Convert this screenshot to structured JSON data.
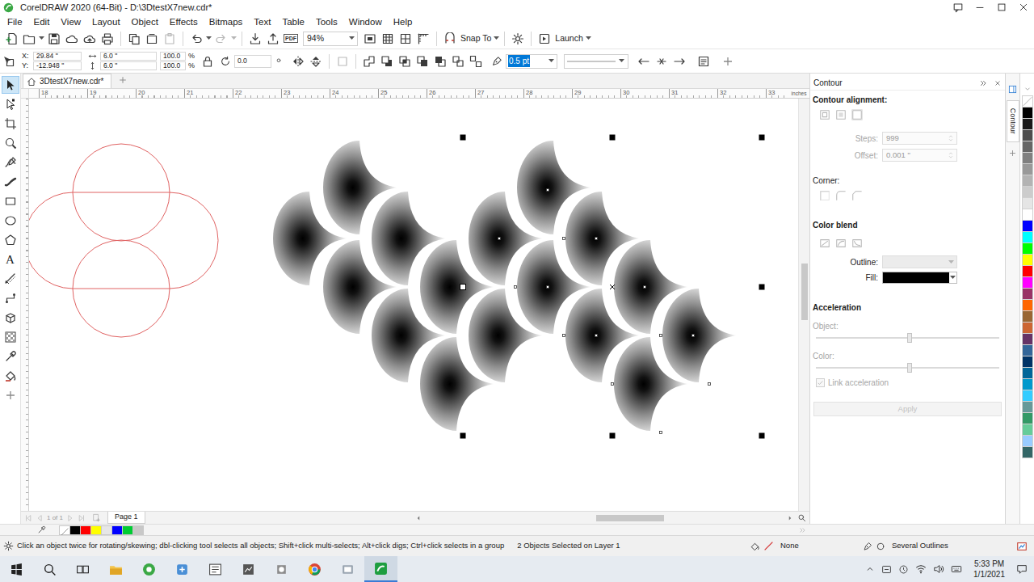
{
  "window": {
    "title": "CorelDRAW 2020 (64-Bit) - D:\\3DtestX7new.cdr*"
  },
  "menu": [
    "File",
    "Edit",
    "View",
    "Layout",
    "Object",
    "Effects",
    "Bitmaps",
    "Text",
    "Table",
    "Tools",
    "Window",
    "Help"
  ],
  "standard_toolbar": {
    "pdf_label": "PDF",
    "zoom": "94%",
    "snap_to": "Snap To",
    "launch": "Launch"
  },
  "property_bar": {
    "x_label": "X:",
    "x": "29.84 \"",
    "y_label": "Y:",
    "y": "-12.948 \"",
    "width": "6.0 \"",
    "height": "6.0 \"",
    "scale": [
      {
        "value": "100.0",
        "unit": "%"
      },
      {
        "value": "100.0",
        "unit": "%"
      }
    ],
    "rotation": "0.0",
    "outline_width": "0.5 pt",
    "outline_width_highlighted": true
  },
  "toolbox": {
    "tools": [
      {
        "selected": true
      },
      {
        "selected": false
      },
      {
        "selected": false
      },
      {
        "selected": false
      },
      {
        "selected": false
      },
      {
        "selected": false
      },
      {
        "selected": false
      },
      {
        "selected": false
      },
      {
        "selected": false
      },
      {
        "glyph": "A",
        "selected": false
      },
      {
        "selected": false
      },
      {
        "selected": false
      },
      {
        "selected": false
      },
      {
        "selected": false
      },
      {
        "selected": false
      },
      {
        "selected": false
      },
      {
        "selected": false
      }
    ]
  },
  "document_tabs": [
    {
      "label": "3DtestX7new.cdr*",
      "selected": true
    }
  ],
  "ruler": {
    "ticks": [
      "18",
      "19",
      "20",
      "21",
      "22",
      "23",
      "24",
      "25",
      "26",
      "27",
      "28",
      "29",
      "30",
      "31",
      "32",
      "33"
    ],
    "unit": "inches"
  },
  "page_nav": {
    "counter": "1 of 1",
    "tabs": [
      {
        "label": "Page 1",
        "selected": true
      }
    ]
  },
  "docker": {
    "title": "Contour",
    "alignment_label": "Contour alignment:",
    "steps": {
      "label": "Steps:",
      "value": "999",
      "disabled": true
    },
    "offset": {
      "label": "Offset:",
      "value": "0.001 \"",
      "disabled": true
    },
    "corner_label": "Corner:",
    "color_blend_label": "Color blend",
    "outline": {
      "label": "Outline:",
      "disabled": true
    },
    "fill": {
      "label": "Fill:",
      "color": "#000000"
    },
    "acceleration_label": "Acceleration",
    "sliders": [
      {
        "label": "Object:",
        "level": 0.51,
        "disabled": true
      },
      {
        "label": "Color:",
        "level": 0.51,
        "disabled": true
      }
    ],
    "link_acceleration": {
      "label": "Link acceleration",
      "checked": true,
      "disabled": true
    },
    "apply": {
      "label": "Apply",
      "disabled": true
    }
  },
  "docker_tabs": [
    {
      "label": "Contour",
      "selected": true
    }
  ],
  "color_palette": [
    {
      "kind": "none"
    },
    {
      "kind": "swatch",
      "color": "#000000"
    },
    {
      "kind": "swatch",
      "color": "#1a1a1a"
    },
    {
      "kind": "swatch",
      "color": "#4d4d4d"
    },
    {
      "kind": "swatch",
      "color": "#666666"
    },
    {
      "kind": "swatch",
      "color": "#808080"
    },
    {
      "kind": "swatch",
      "color": "#999999"
    },
    {
      "kind": "swatch",
      "color": "#b3b3b3"
    },
    {
      "kind": "swatch",
      "color": "#cccccc"
    },
    {
      "kind": "swatch",
      "color": "#e5e5e5"
    },
    {
      "kind": "swatch",
      "color": "#ffffff"
    },
    {
      "kind": "swatch",
      "color": "#0000ff"
    },
    {
      "kind": "swatch",
      "color": "#00ffff"
    },
    {
      "kind": "swatch",
      "color": "#00ff00"
    },
    {
      "kind": "swatch",
      "color": "#ffff00"
    },
    {
      "kind": "swatch",
      "color": "#ff0000"
    },
    {
      "kind": "swatch",
      "color": "#ff00ff"
    },
    {
      "kind": "swatch",
      "color": "#993366"
    },
    {
      "kind": "swatch",
      "color": "#ff6600"
    },
    {
      "kind": "swatch",
      "color": "#996633"
    },
    {
      "kind": "swatch",
      "color": "#cc6633"
    },
    {
      "kind": "swatch",
      "color": "#663366"
    },
    {
      "kind": "swatch",
      "color": "#336699"
    },
    {
      "kind": "swatch",
      "color": "#003366"
    },
    {
      "kind": "swatch",
      "color": "#006699"
    },
    {
      "kind": "swatch",
      "color": "#0099cc"
    },
    {
      "kind": "swatch",
      "color": "#33ccff"
    },
    {
      "kind": "swatch",
      "color": "#669999"
    },
    {
      "kind": "swatch",
      "color": "#339966"
    },
    {
      "kind": "swatch",
      "color": "#66cc99"
    },
    {
      "kind": "swatch",
      "color": "#99ccff"
    },
    {
      "kind": "swatch",
      "color": "#336666"
    }
  ],
  "document_palette": [
    {
      "kind": "none"
    },
    {
      "kind": "swatch",
      "color": "#000000"
    },
    {
      "kind": "swatch",
      "color": "#ff0000"
    },
    {
      "kind": "swatch",
      "color": "#ffff00"
    },
    {
      "kind": "swatch",
      "color": "#e6e6e6"
    },
    {
      "kind": "swatch",
      "color": "#0000ff"
    },
    {
      "kind": "swatch",
      "color": "#00cc33"
    },
    {
      "kind": "swatch",
      "color": "#c8c8c8"
    }
  ],
  "status_bar": {
    "hint": "Click an object twice for rotating/skewing; dbl-clicking tool selects all objects; Shift+click multi-selects; Alt+click digs; Ctrl+click selects in a group",
    "selection": "2 Objects Selected on Layer 1",
    "fill": "None",
    "outline": "Several Outlines"
  },
  "taskbar": {
    "apps": [
      {
        "active": false
      },
      {
        "active": false
      },
      {
        "active": false
      },
      {
        "active": false
      },
      {
        "active": false
      },
      {
        "active": false
      },
      {
        "active": false
      },
      {
        "active": false
      },
      {
        "active": false
      },
      {
        "active": false
      },
      {
        "active": false
      },
      {
        "active": true
      }
    ],
    "time": "5:33 PM",
    "date": "1/1/2021"
  }
}
